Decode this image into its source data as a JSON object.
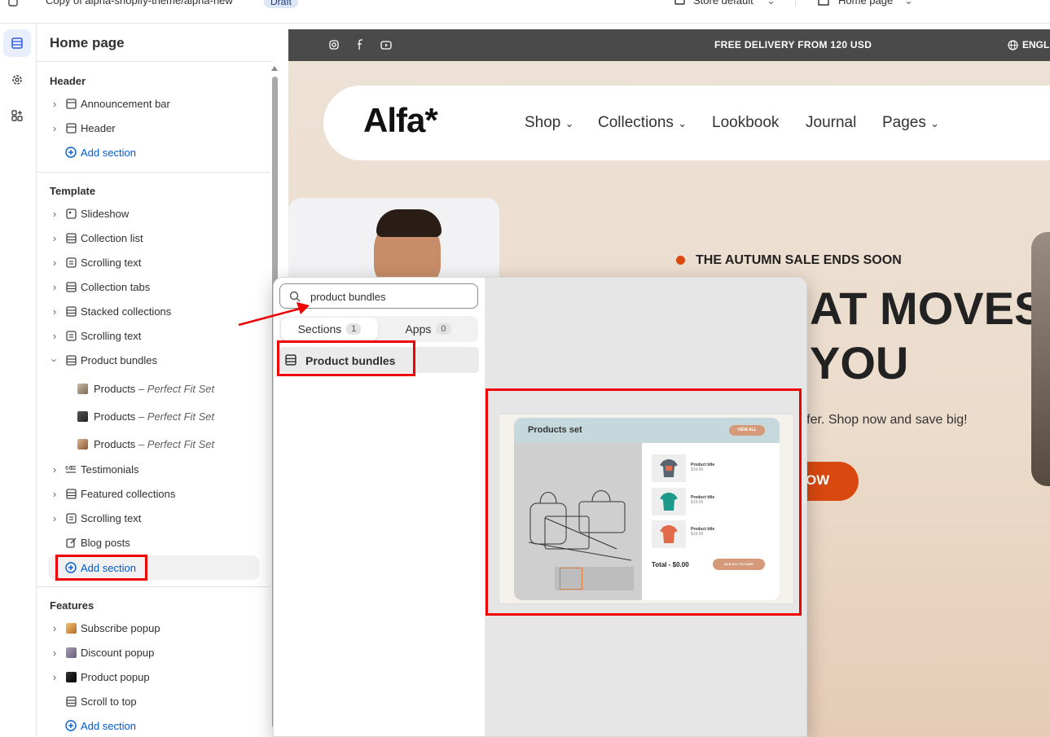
{
  "topbar": {
    "theme_name": "Copy of alpha-shopify-theme/alpha-new",
    "badge": "Draft",
    "more": "···",
    "store_selector": "Store default",
    "page_selector": "Home page"
  },
  "sidebar": {
    "title": "Home page",
    "header_group": {
      "heading": "Header",
      "items": [
        "Announcement bar",
        "Header"
      ],
      "add_label": "Add section"
    },
    "template_group": {
      "heading": "Template",
      "items": [
        "Slideshow",
        "Collection list",
        "Scrolling text",
        "Collection tabs",
        "Stacked collections",
        "Scrolling text",
        "Product bundles"
      ],
      "bundle_blocks": [
        {
          "label": "Products",
          "detail": "– Perfect Fit Set"
        },
        {
          "label": "Products",
          "detail": "– Perfect Fit Set"
        },
        {
          "label": "Products",
          "detail": "– Perfect Fit Set"
        }
      ],
      "items_after": [
        "Testimonials",
        "Featured collections",
        "Scrolling text",
        "Blog posts"
      ],
      "add_label": "Add section"
    },
    "features_group": {
      "heading": "Features",
      "items": [
        "Subscribe popup",
        "Discount popup",
        "Product popup",
        "Scroll to top"
      ],
      "add_label": "Add section"
    }
  },
  "preview": {
    "announcement": "FREE DELIVERY FROM 120 USD",
    "language": "ENGL",
    "logo": "Alfa*",
    "nav": [
      "Shop",
      "Collections",
      "Lookbook",
      "Journal",
      "Pages"
    ],
    "sale_label": "THE AUTUMN SALE ENDS SOON",
    "headline_1": "AT MOVES",
    "headline_2": "YOU",
    "subtext": "ffer. Shop now and save big!",
    "cta": "OW"
  },
  "popup": {
    "search_value": "product bundles",
    "tabs": [
      {
        "label": "Sections",
        "count": "1"
      },
      {
        "label": "Apps",
        "count": "0"
      }
    ],
    "result": "Product bundles",
    "preview_card": {
      "title": "Products set",
      "view_all": "VIEW ALL",
      "products": [
        {
          "title": "Product title",
          "price": "$19.99"
        },
        {
          "title": "Product title",
          "price": "$19.99"
        },
        {
          "title": "Product title",
          "price": "$19.99"
        }
      ],
      "total": "Total - $0.00",
      "add_all": "ADD ALL TO CART"
    }
  },
  "colors": {
    "accent_blue": "#005bd3",
    "annotation_red": "#ee0000",
    "sale_dot": "#d9480f",
    "cta": "#d9480f"
  }
}
